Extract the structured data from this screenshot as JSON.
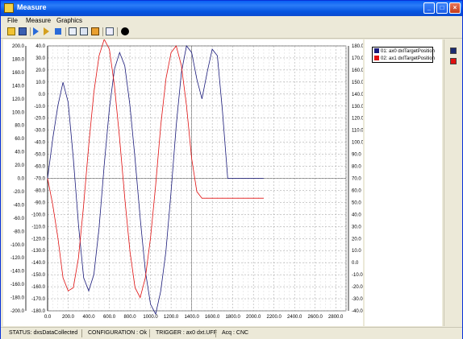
{
  "window": {
    "title": "Measure"
  },
  "menu": {
    "items": [
      "File",
      "Measure",
      "Graphics"
    ]
  },
  "toolbar": {
    "icons": [
      "open-icon",
      "save-icon",
      "play-icon",
      "step-icon",
      "stop-icon",
      "edit-icon",
      "grid-icon",
      "export-icon",
      "zoom-icon",
      "record-icon"
    ]
  },
  "legend": {
    "entries": [
      {
        "label": "01: ax0 dxlTargetPosition",
        "color": "#1a1a7a"
      },
      {
        "label": "02: ax1 dxlTargetPosition",
        "color": "#e01010"
      }
    ]
  },
  "right_panel": {
    "swatches": [
      "#1a2a70",
      "#e01010"
    ]
  },
  "status": {
    "status": "STATUS: dxsDataCollected",
    "configuration": "CONFIGURATION : Ok",
    "trigger": "TRIGGER : ax0 dxt.UFF",
    "acq": "Acq : CNC"
  },
  "chart_data": {
    "type": "line",
    "x_ticks": [
      "0.0",
      "200.0",
      "400.0",
      "600.0",
      "800.0",
      "1000.0",
      "1200.0",
      "1400.0",
      "1600.0",
      "1800.0",
      "2000.0",
      "2200.0",
      "2400.0",
      "2600.0",
      "2800.0"
    ],
    "xlim": [
      0,
      2900
    ],
    "y_left_outer_ticks": [
      "200.0",
      "180.0",
      "160.0",
      "140.0",
      "120.0",
      "100.0",
      "80.0",
      "60.0",
      "40.0",
      "20.0",
      "0.0",
      "-20.0",
      "-40.0",
      "-60.0",
      "-80.0",
      "-100.0",
      "-120.0",
      "-140.0",
      "-160.0",
      "-180.0",
      "-200.0"
    ],
    "y_left_outer_lim": [
      -200,
      200
    ],
    "y_left_inner_ticks": [
      "40.0",
      "30.0",
      "20.0",
      "10.0",
      "0.0",
      "-10.0",
      "-20.0",
      "-30.0",
      "-40.0",
      "-50.0",
      "-60.0",
      "-70.0",
      "-80.0",
      "-90.0",
      "-100.0",
      "-110.0",
      "-120.0",
      "-130.0",
      "-140.0",
      "-150.0",
      "-160.0",
      "-170.0",
      "-180.0"
    ],
    "y_left_inner_lim": [
      -180,
      40
    ],
    "y_right_ticks": [
      "180.0",
      "170.0",
      "160.0",
      "150.0",
      "140.0",
      "130.0",
      "120.0",
      "110.0",
      "100.0",
      "90.0",
      "80.0",
      "70.0",
      "60.0",
      "50.0",
      "40.0",
      "30.0",
      "20.0",
      "10.0",
      "0.0",
      "-10.0",
      "-20.0",
      "-30.0",
      "-40.0"
    ],
    "y_right_lim": [
      -40,
      180
    ],
    "series": [
      {
        "name": "01: ax0 dxlTargetPosition",
        "color": "#1a1a7a",
        "x": [
          0,
          50,
          100,
          150,
          200,
          250,
          300,
          350,
          400,
          450,
          500,
          550,
          600,
          650,
          700,
          750,
          800,
          850,
          900,
          950,
          1000,
          1050,
          1100,
          1150,
          1200,
          1250,
          1300,
          1350,
          1400,
          1450,
          1500,
          1550,
          1600,
          1650,
          1700,
          1750,
          1800,
          2100
        ],
        "y": [
          0,
          60,
          110,
          145,
          115,
          30,
          -70,
          -150,
          -170,
          -145,
          -75,
          20,
          105,
          165,
          190,
          170,
          110,
          30,
          -60,
          -140,
          -190,
          -205,
          -170,
          -110,
          -20,
          80,
          160,
          200,
          190,
          150,
          120,
          160,
          195,
          185,
          100,
          0,
          0,
          0
        ]
      },
      {
        "name": "02: ax1 dxlTargetPosition",
        "color": "#e01010",
        "x": [
          0,
          50,
          100,
          150,
          200,
          250,
          300,
          350,
          400,
          450,
          500,
          550,
          600,
          650,
          700,
          750,
          800,
          850,
          900,
          950,
          1000,
          1050,
          1100,
          1150,
          1200,
          1250,
          1300,
          1350,
          1400,
          1450,
          1500,
          1550,
          1600,
          1650,
          1700,
          1750,
          1800,
          2100
        ],
        "y": [
          0,
          -40,
          -90,
          -150,
          -170,
          -165,
          -120,
          -40,
          50,
          130,
          185,
          210,
          195,
          140,
          60,
          -30,
          -110,
          -165,
          -180,
          -150,
          -90,
          -10,
          80,
          150,
          190,
          200,
          170,
          110,
          30,
          -20,
          -30,
          -30,
          -30,
          -30,
          -30,
          -30,
          -30,
          -30
        ]
      }
    ]
  }
}
